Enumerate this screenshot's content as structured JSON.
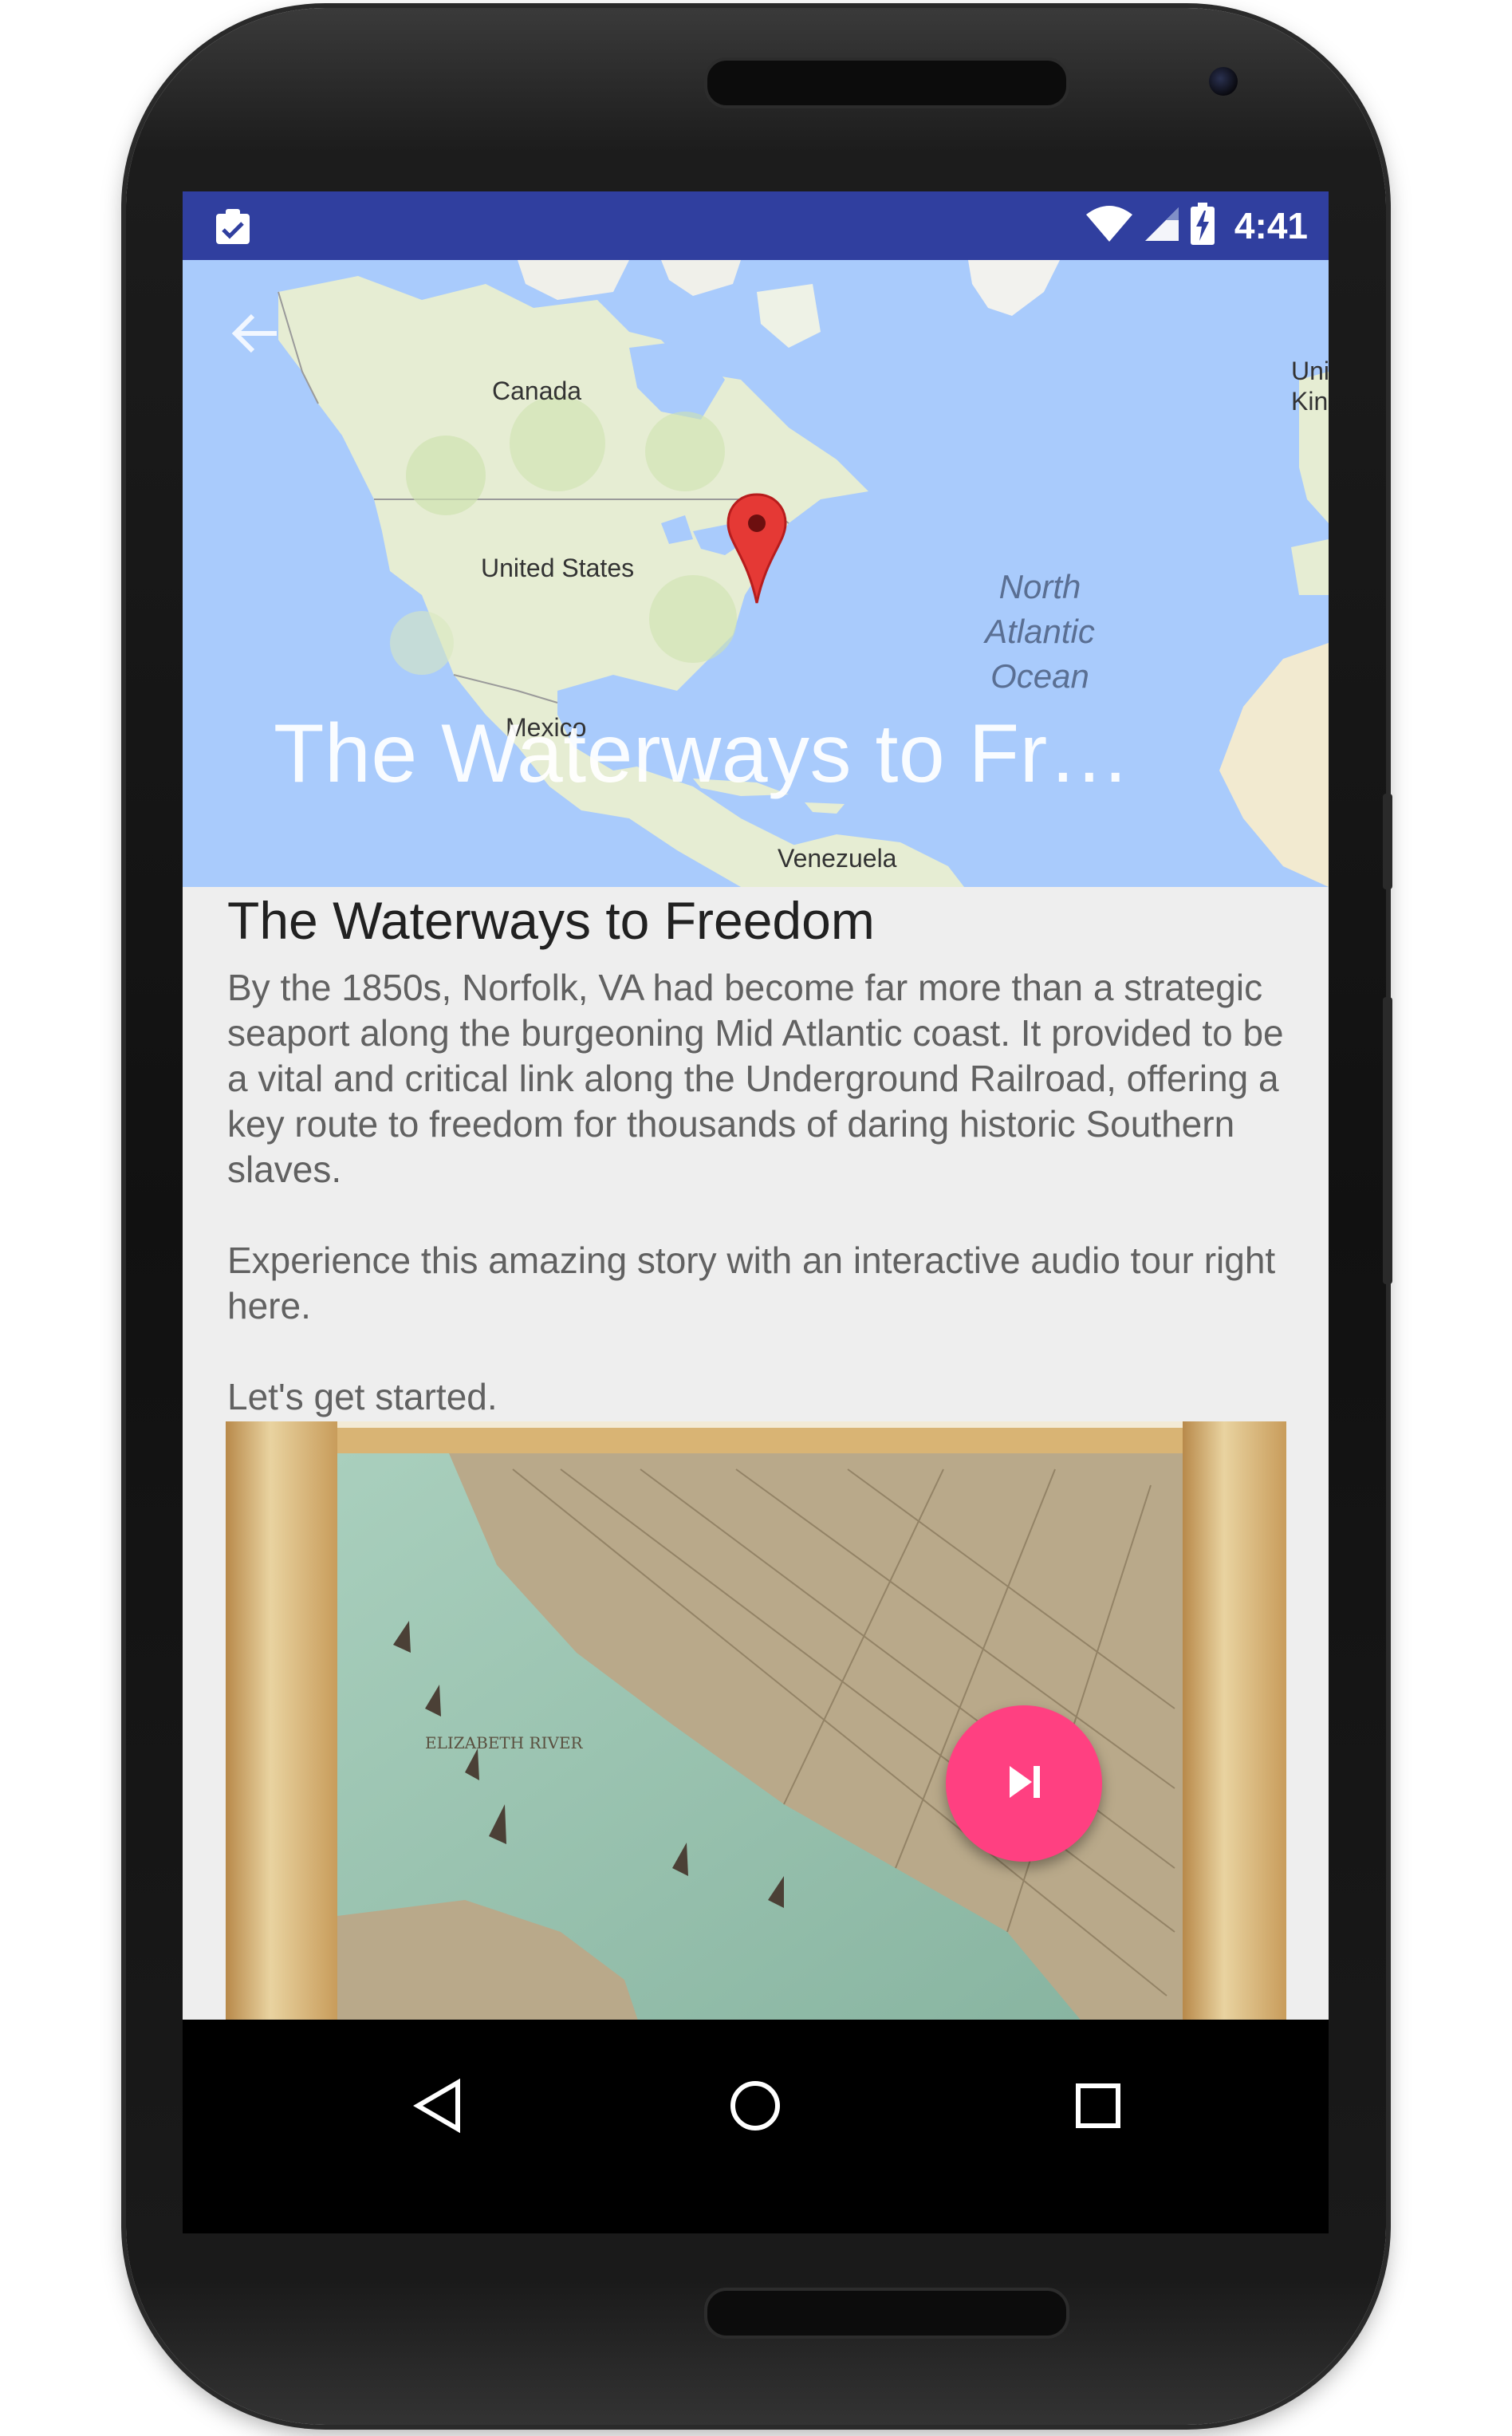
{
  "status_bar": {
    "time": "4:41",
    "icons": [
      "notification-clipboard-icon",
      "wifi-icon",
      "signal-icon",
      "battery-charging-icon"
    ],
    "background_color": "#303f9f"
  },
  "header": {
    "collapsed_title": "The Waterways to Fr…",
    "map_labels": {
      "canada": "Canada",
      "united_states": "United States",
      "mexico": "Mexico",
      "venezuela": "Venezuela",
      "uk_line1": "Uni",
      "uk_line2": "King",
      "ocean_line1": "North",
      "ocean_line2": "Atlantic",
      "ocean_line3": "Ocean"
    },
    "marker_color": "#e53935",
    "ocean_color": "#a9cbfc",
    "land_color": "#e8efd9"
  },
  "content": {
    "title": "The Waterways to Freedom",
    "paragraph_1": "By the 1850s, Norfolk, VA had become far more than a strategic seaport along the burgeoning Mid Atlantic coast. It provided to be a vital and critical link along the Underground Railroad, offering a key route to freedom for thousands of daring historic Southern slaves.",
    "paragraph_2": "Experience this amazing story with an interactive audio tour right here.",
    "paragraph_3": "Let's get started.",
    "image_caption": "ELIZABETH    RIVER"
  },
  "fab": {
    "icon": "skip-next-icon",
    "color": "#ff4081"
  },
  "nav_bar": {
    "buttons": [
      "back-icon",
      "home-icon",
      "recents-icon"
    ]
  }
}
